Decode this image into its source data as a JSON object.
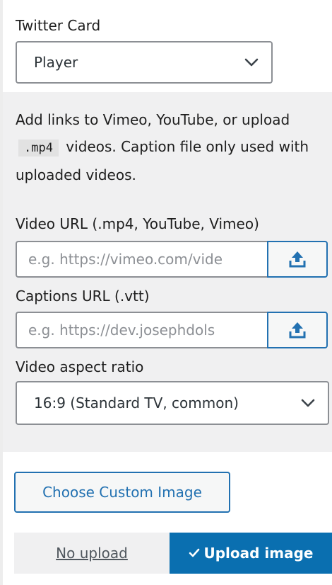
{
  "twitter_card": {
    "label": "Twitter Card",
    "selected": "Player"
  },
  "player": {
    "description_before": "Add links to Vimeo, YouTube, or upload ",
    "description_code": ".mp4",
    "description_after": " videos. Caption file only used with uploaded videos.",
    "video_url": {
      "label": "Video URL (.mp4, YouTube, Vimeo)",
      "placeholder": "e.g. https://vimeo.com/vide"
    },
    "captions_url": {
      "label": "Captions URL (.vtt)",
      "placeholder": "e.g. https://dev.josephdols"
    },
    "aspect_ratio": {
      "label": "Video aspect ratio",
      "selected": "16:9 (Standard TV, common)"
    }
  },
  "image": {
    "choose_label": "Choose Custom Image",
    "no_upload_label": "No upload",
    "upload_label": "Upload image",
    "active": "Upload image"
  },
  "colors": {
    "accent": "#2271b1",
    "active_toggle": "#0a6fb0",
    "panel_gray": "#f0f0f1"
  },
  "icons": {
    "select_arrow": "chevron-down-icon",
    "upload": "upload-icon",
    "check": "check-icon"
  }
}
